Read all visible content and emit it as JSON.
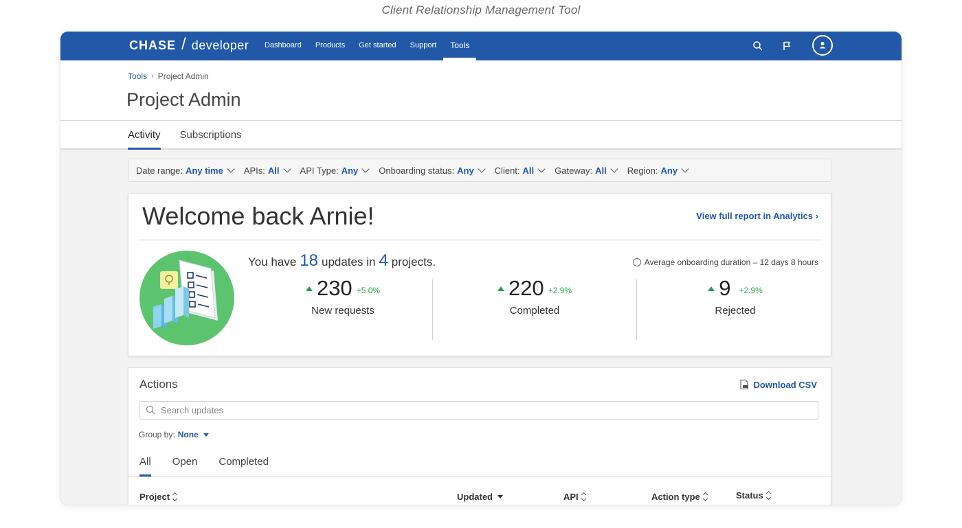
{
  "caption": "Client Relationship Management Tool",
  "brand": {
    "name": "CHASE",
    "separator": "/",
    "product": "developer"
  },
  "nav": {
    "items": [
      "Dashboard",
      "Products",
      "Get started",
      "Support",
      "Tools"
    ],
    "active": "Tools"
  },
  "nav_icons": [
    "search-icon",
    "flag-icon",
    "user-avatar-icon"
  ],
  "breadcrumb": {
    "parent": "Tools",
    "current": "Project Admin"
  },
  "page_title": "Project Admin",
  "tabs": [
    {
      "label": "Activity",
      "active": true
    },
    {
      "label": "Subscriptions",
      "active": false
    }
  ],
  "filters": [
    {
      "label": "Date range:",
      "value": "Any time"
    },
    {
      "label": "APIs:",
      "value": "All"
    },
    {
      "label": "API Type:",
      "value": "Any"
    },
    {
      "label": "Onboarding status:",
      "value": "Any"
    },
    {
      "label": "Client:",
      "value": "All"
    },
    {
      "label": "Gateway:",
      "value": "All"
    },
    {
      "label": "Region:",
      "value": "Any"
    }
  ],
  "welcome": {
    "title": "Welcome back Arnie!",
    "report_link": "View full report in Analytics",
    "summary_prefix": "You have",
    "updates_count": "18",
    "summary_middle": "updates in",
    "projects_count": "4",
    "summary_suffix": "projects.",
    "avg_onboarding": "Average onboarding duration – 12 days 8 hours"
  },
  "stats": [
    {
      "value": "230",
      "delta": "+5.0%",
      "label": "New requests",
      "trend": "up"
    },
    {
      "value": "220",
      "delta": "+2.9%",
      "label": "Completed",
      "trend": "up"
    },
    {
      "value": "9",
      "delta": "+2.9%",
      "label": "Rejected",
      "trend": "up"
    }
  ],
  "actions": {
    "title": "Actions",
    "download_label": "Download CSV",
    "search_placeholder": "Search updates",
    "group_by_label": "Group by:",
    "group_by_value": "None",
    "tabs": [
      {
        "label": "All",
        "active": true
      },
      {
        "label": "Open",
        "active": false
      },
      {
        "label": "Completed",
        "active": false
      }
    ],
    "columns": [
      {
        "label": "Project",
        "sort": "both"
      },
      {
        "label": "Updated",
        "sort": "desc"
      },
      {
        "label": "API",
        "sort": "both"
      },
      {
        "label": "Action type",
        "sort": "both"
      },
      {
        "label": "Status",
        "sort": "both"
      }
    ]
  },
  "colors": {
    "primary": "#2158a8",
    "positive": "#2e9d4b",
    "illustration_bg": "#5cc46e"
  }
}
